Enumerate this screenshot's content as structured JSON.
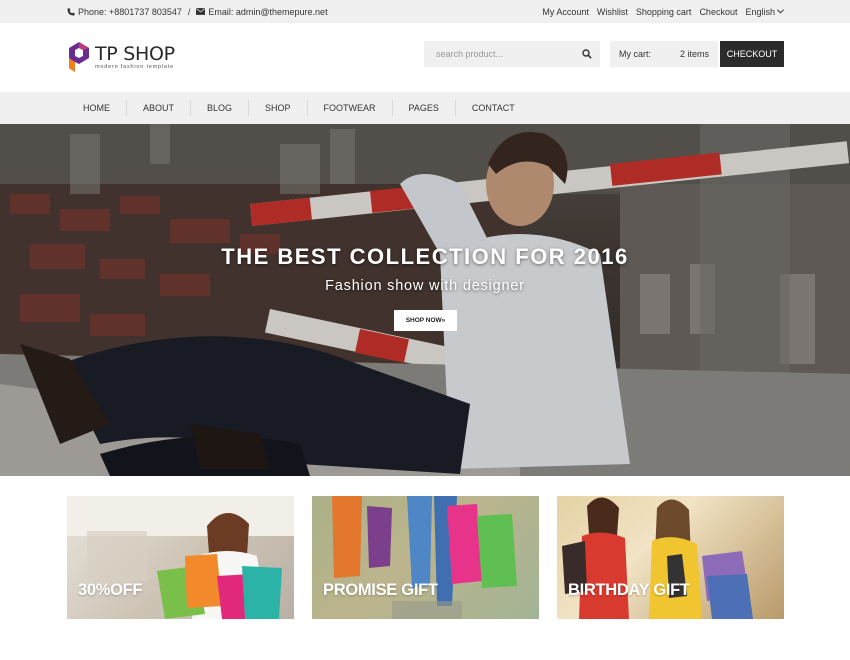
{
  "topbar": {
    "phone": "Phone: +8801737 803547",
    "separator": "/",
    "email": "Email: admin@themepure.net",
    "links": [
      "My Account",
      "Wishlist",
      "Shopping cart",
      "Checkout"
    ],
    "language": "English"
  },
  "header": {
    "brand": "TP SHOP",
    "tagline": "modern fashion template",
    "search_placeholder": "search product...",
    "cart_label": "My cart:",
    "cart_count": "2 items",
    "checkout_label": "CHECKOUT"
  },
  "nav": {
    "items": [
      "HOME",
      "ABOUT",
      "BLOG",
      "SHOP",
      "FOOTWEAR",
      "PAGES",
      "CONTACT"
    ]
  },
  "hero": {
    "title": "THE BEST COLLECTION FOR 2016",
    "subtitle": "Fashion show with designer",
    "button": "SHOP NOW»"
  },
  "banners": [
    {
      "caption": "30%OFF"
    },
    {
      "caption": "PROMISE GIFT"
    },
    {
      "caption": "BIRTHDAY GIFT"
    }
  ],
  "colors": {
    "topbar_bg": "#f0f0f0",
    "checkout_bg": "#2b2b2b",
    "logo_purple": "#6a2c91",
    "logo_orange": "#f0801e"
  }
}
